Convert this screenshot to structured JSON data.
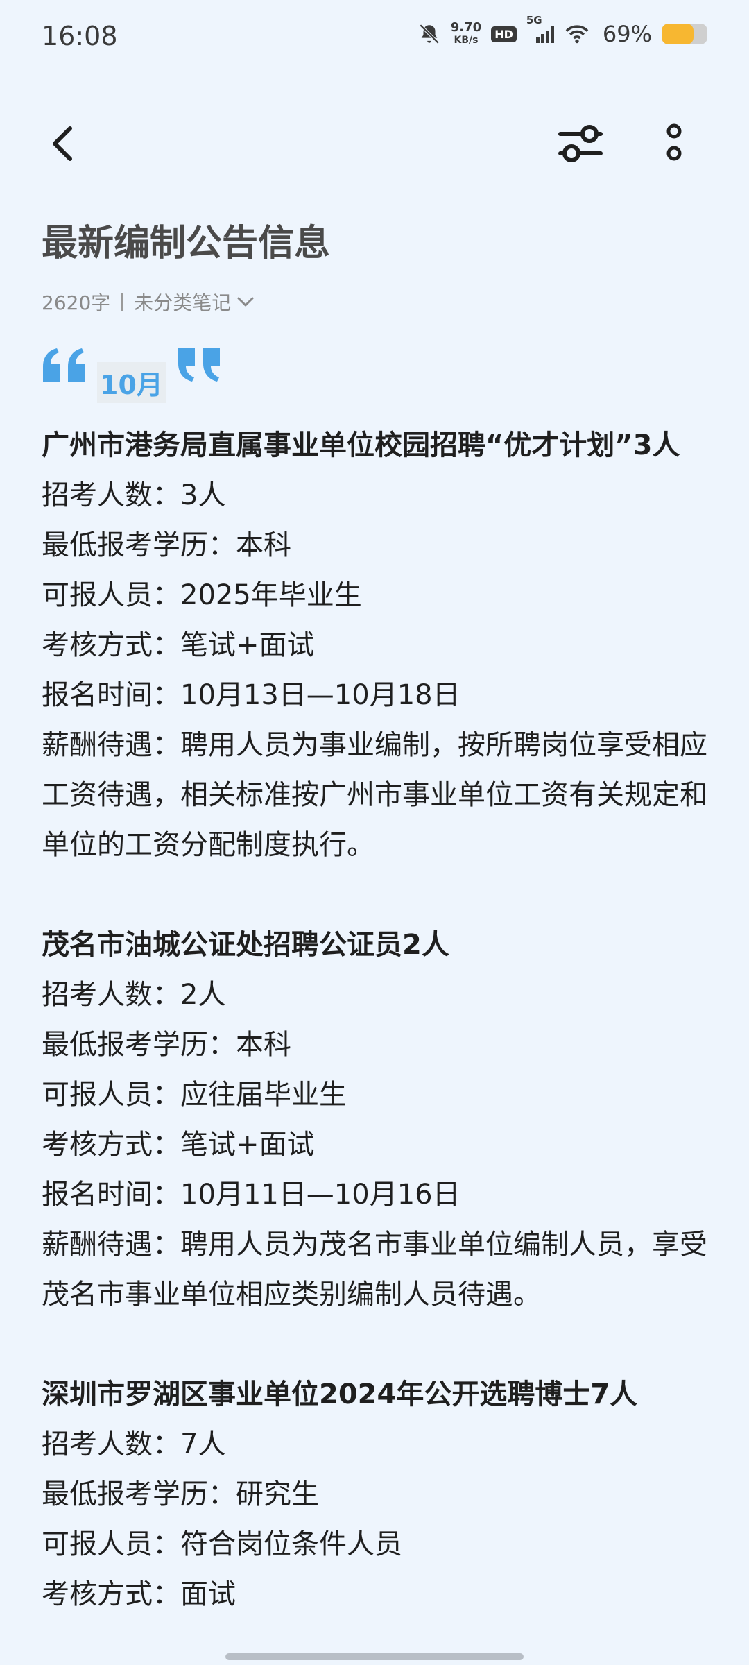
{
  "status_bar": {
    "time": "16:08",
    "net_speed_value": "9.70",
    "net_speed_unit": "KB/s",
    "hd_label": "HD",
    "network_label": "5G",
    "battery_percent": "69%",
    "battery_level": 0.69,
    "icons": [
      "bell-off-icon",
      "signal-icon",
      "wifi-icon",
      "battery-icon"
    ]
  },
  "toolbar": {
    "back_icon": "chevron-left-icon",
    "filter_icon": "sliders-icon",
    "more_icon": "more-vertical-icon"
  },
  "note": {
    "title": "最新编制公告信息",
    "char_count": "2620字",
    "category": "未分类笔记",
    "quote_text": "10月"
  },
  "colors": {
    "background": "#eef5fd",
    "accent_blue": "#4aa3e6",
    "battery_yellow": "#f7b731"
  },
  "sections": [
    {
      "title": "广州市港务局直属事业单位校园招聘“优才计划”3人",
      "fields": [
        "招考人数：3人",
        "最低报考学历：本科",
        "可报人员：2025年毕业生",
        "考核方式：笔试+面试",
        "报名时间：10月13日—10月18日",
        "薪酬待遇：聘用人员为事业编制，按所聘岗位享受相应工资待遇，相关标准按广州市事业单位工资有关规定和单位的工资分配制度执行。"
      ]
    },
    {
      "title": "茂名市油城公证处招聘公证员2人",
      "fields": [
        "招考人数：2人",
        "最低报考学历：本科",
        "可报人员：应往届毕业生",
        "考核方式：笔试+面试",
        "报名时间：10月11日—10月16日",
        "薪酬待遇：聘用人员为茂名市事业单位编制人员，享受茂名市事业单位相应类别编制人员待遇。"
      ]
    },
    {
      "title": "深圳市罗湖区事业单位2024年公开选聘博士7人",
      "fields": [
        "招考人数：7人",
        "最低报考学历：研究生",
        "可报人员：符合岗位条件人员",
        "考核方式：面试"
      ]
    }
  ]
}
